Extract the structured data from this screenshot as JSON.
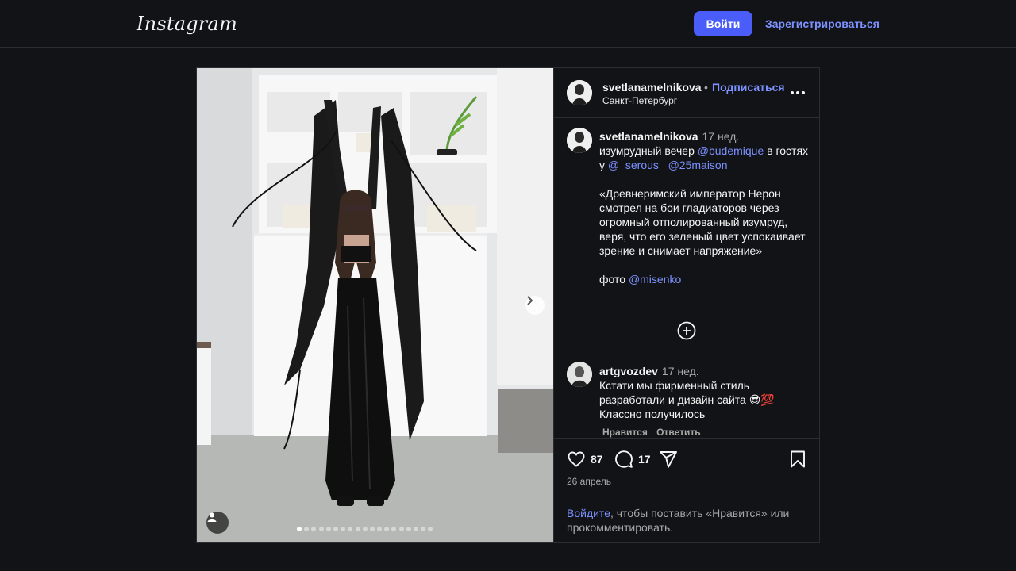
{
  "header": {
    "logo": "Instagram",
    "login_button": "Войти",
    "signup_link": "Зарегистрироваться"
  },
  "post": {
    "author": "svetlanamelnikova",
    "separator": "•",
    "follow": "Подписаться",
    "location": "Санкт-Петербург",
    "carousel": {
      "current": 1,
      "total": 19
    },
    "caption": {
      "username": "svetlanamelnikova",
      "time": "17 нед.",
      "line1_text": "изумрудный вечер ",
      "mention1": "@budemique",
      "line1_tail": " в гостях у ",
      "mention2": "@_serous_",
      "mention3": "@25maison",
      "quote": "«Древнеримский император Нерон смотрел на бои гладиаторов через огромный отполированный изумруд, веря, что его зеленый цвет успокаивает зрение и снимает напряжение»",
      "photo_label": "фото ",
      "mention4": "@misenko"
    },
    "comment": {
      "username": "artgvozdev",
      "time": "17 нед.",
      "text": "Кстати мы фирменный стиль разработали и дизайн сайта 😎💯 Классно получилось",
      "like_label": "Нравится",
      "reply_label": "Ответить"
    },
    "likes": "87",
    "comments_count": "17",
    "date": "26 апрель",
    "login_prompt_link": "Войдите",
    "login_prompt_text": ", чтобы поставить «Нравится» или прокомментировать."
  },
  "icons": {
    "heart": "heart-icon",
    "comment": "comment-icon",
    "share": "share-icon",
    "bookmark": "bookmark-icon",
    "more": "more-icon",
    "add": "plus-circle-icon",
    "next": "chevron-right-icon",
    "tag": "user-tag-icon"
  },
  "colors": {
    "accent": "#4a5df9",
    "link": "#7d92ff",
    "background": "#121317"
  }
}
